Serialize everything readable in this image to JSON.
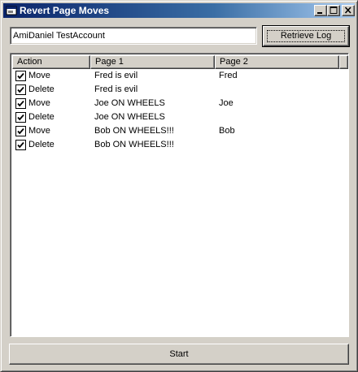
{
  "window": {
    "title": "Revert Page Moves",
    "title_icon": "app-window-icon",
    "controls": [
      "minimize-icon",
      "maximize-icon",
      "close-icon"
    ]
  },
  "username_field": {
    "value": "AmiDaniel TestAccount"
  },
  "retrieve_button": {
    "label": "Retrieve Log"
  },
  "log_list": {
    "columns": [
      "Action",
      "Page 1",
      "Page 2"
    ],
    "rows": [
      {
        "checked": true,
        "action": "Move",
        "page1": "Fred is evil",
        "page2": "Fred"
      },
      {
        "checked": true,
        "action": "Delete",
        "page1": "Fred is evil",
        "page2": ""
      },
      {
        "checked": true,
        "action": "Move",
        "page1": "Joe ON WHEELS",
        "page2": "Joe"
      },
      {
        "checked": true,
        "action": "Delete",
        "page1": "Joe ON WHEELS",
        "page2": ""
      },
      {
        "checked": true,
        "action": "Move",
        "page1": "Bob ON WHEELS!!!",
        "page2": "Bob"
      },
      {
        "checked": true,
        "action": "Delete",
        "page1": "Bob ON WHEELS!!!",
        "page2": ""
      }
    ]
  },
  "start_button": {
    "label": "Start"
  },
  "colors": {
    "face": "#d4d0c8",
    "title_start": "#0a246a",
    "title_end": "#a6caf0"
  }
}
